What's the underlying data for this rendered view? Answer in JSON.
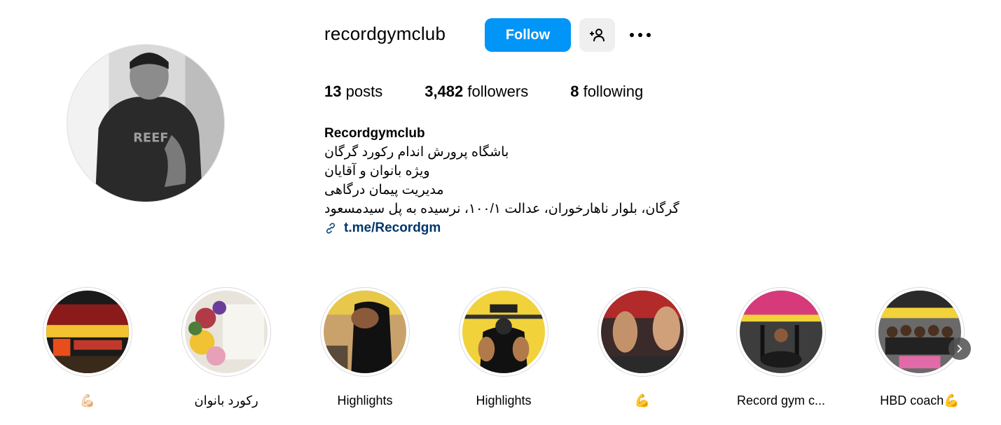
{
  "profile": {
    "username": "recordgymclub",
    "follow_label": "Follow",
    "suggest_icon": "person-add-icon",
    "more_icon": "more-options-icon"
  },
  "stats": {
    "posts_count": "13",
    "posts_label": "posts",
    "followers_count": "3,482",
    "followers_label": "followers",
    "following_count": "8",
    "following_label": "following"
  },
  "bio": {
    "name": "Recordgymclub",
    "lines": [
      "باشگاه پرورش اندام رکورد گرگان",
      "ویژه بانوان و آقایان",
      "مدیریت پیمان درگاهی",
      "گرگان، بلوار ناهارخوران، عدالت ۱۰۰/۱، نرسیده به پل سیدمسعود"
    ],
    "link_icon": "link-icon",
    "link_text": "t.me/Recordgm"
  },
  "highlights": [
    {
      "label": "💪🏻",
      "theme": "storefront"
    },
    {
      "label": "رکورد بانوان",
      "theme": "flowers"
    },
    {
      "label": "Highlights",
      "theme": "gym-back"
    },
    {
      "label": "Highlights",
      "theme": "gym-yellow"
    },
    {
      "label": "💪",
      "theme": "gym-red"
    },
    {
      "label": "Record gym c...",
      "theme": "gym-pink"
    },
    {
      "label": "HBD coach💪",
      "theme": "group-photo"
    }
  ],
  "next_icon": "chevron-right-icon",
  "colors": {
    "primary_button": "#0095f6",
    "secondary_button": "#efefef",
    "link": "#00376b"
  }
}
